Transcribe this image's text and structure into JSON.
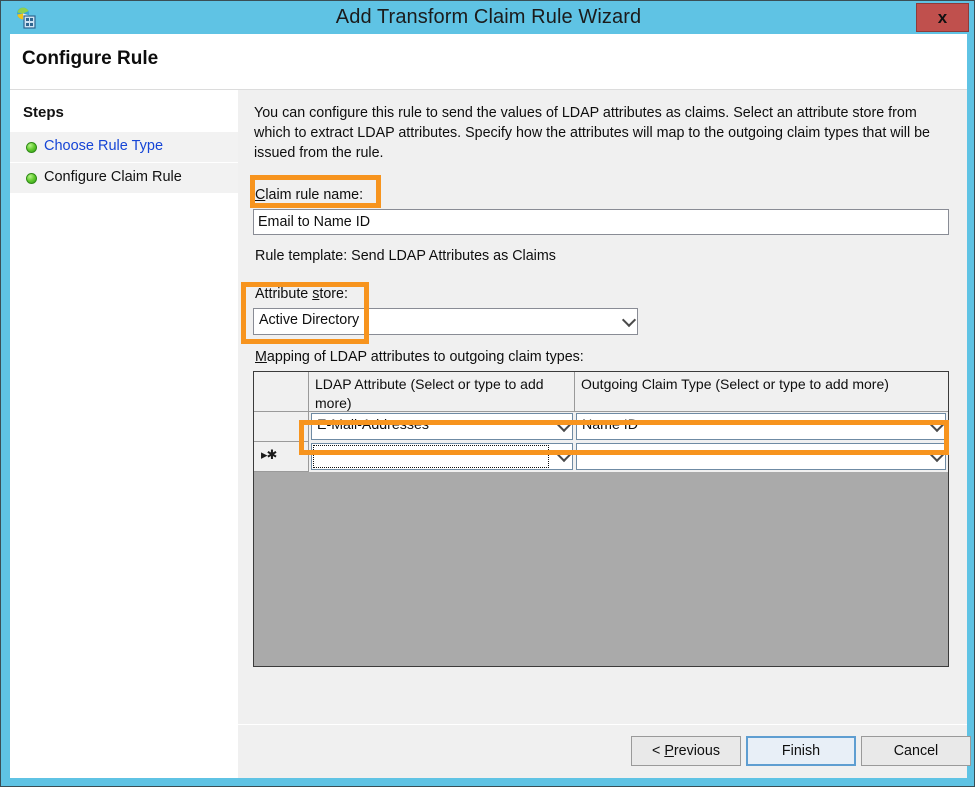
{
  "window": {
    "title": "Add Transform Claim Rule Wizard",
    "icon": "server-globe-icon",
    "close_label": "x",
    "titlebar_color": "#5fc3e4",
    "close_button_color": "#c0504d"
  },
  "page": {
    "header_title": "Configure Rule"
  },
  "sidebar": {
    "heading": "Steps",
    "items": [
      {
        "label": "Choose Rule Type",
        "state": "link"
      },
      {
        "label": "Configure Claim Rule",
        "state": "current"
      }
    ]
  },
  "main": {
    "intro": "You can configure this rule to send the values of LDAP attributes as claims. Select an attribute store from which to extract LDAP attributes. Specify how the attributes will map to the outgoing claim types that will be issued from the rule.",
    "rule_name_label": "Claim rule name:",
    "rule_name_label_accesskey": "C",
    "rule_name_value": "Email to Name ID",
    "rule_template_text": "Rule template: Send LDAP Attributes as Claims",
    "attribute_store_label": "Attribute store:",
    "attribute_store_label_accesskey": "s",
    "attribute_store_value": "Active Directory",
    "mapping_label": "Mapping of LDAP attributes to outgoing claim types:",
    "mapping_label_accesskey": "M"
  },
  "grid": {
    "columns": [
      {
        "header": ""
      },
      {
        "header": "LDAP Attribute (Select or type to add more)"
      },
      {
        "header": "Outgoing Claim Type (Select or type to add more)"
      }
    ],
    "rows": [
      {
        "marker": "",
        "ldap_attribute": "E-Mail-Addresses",
        "outgoing_claim_type": "Name ID"
      },
      {
        "marker": "▸✱",
        "ldap_attribute": "",
        "outgoing_claim_type": ""
      }
    ]
  },
  "highlights": {
    "color": "#F7941E",
    "regions": [
      "claim-rule-name-label",
      "attribute-store-label-and-value",
      "first-mapping-row"
    ]
  },
  "footer": {
    "previous_label": "< Previous",
    "previous_accesskey": "P",
    "finish_label": "Finish",
    "cancel_label": "Cancel"
  }
}
